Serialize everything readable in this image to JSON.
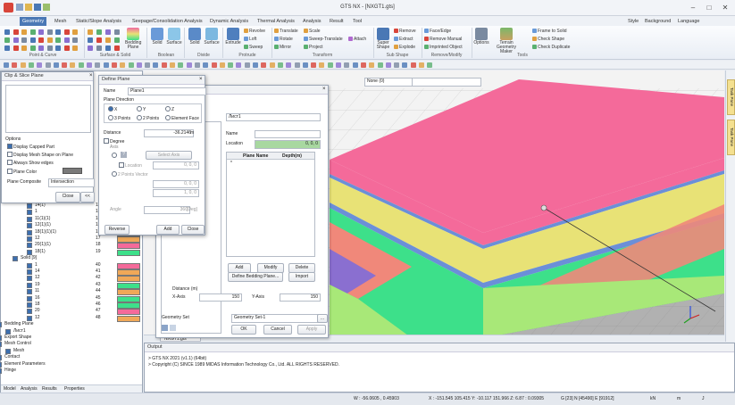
{
  "app": {
    "title": "GTS NX - [NXGT1.gts]"
  },
  "menu": {
    "tabs": [
      "Geometry",
      "Mesh",
      "Static/Slope Analysis",
      "Seepage/Consolidation Analysis",
      "Dynamic Analysis",
      "Thermal Analysis",
      "Analysis",
      "Result",
      "Tool"
    ],
    "right": [
      "Style",
      "Background",
      "Language"
    ]
  },
  "ribbon": {
    "big": [
      "Bedding Plane",
      "Solid",
      "Surface",
      "Solid",
      "Surface",
      "Extrude",
      "Super Shape",
      "Options",
      "Terrain Geometry Maker"
    ],
    "small": {
      "surface_col1": [
        "Revolve",
        "Loft",
        "Sweep"
      ],
      "transform_col1": [
        "Translate",
        "Rotate",
        "Mirror"
      ],
      "transform_col2": [
        "Scale",
        "Sweep-Translate",
        "Project"
      ],
      "transform_col3": [
        "Attach"
      ],
      "sub_col1": [
        "Remove",
        "Extract",
        "Explode"
      ],
      "sub_col2": [
        "Face/Edge",
        "Remove Manual",
        "Imprinted Object"
      ],
      "tools_col1": [
        "Frame to Solid",
        "Check Shape",
        "Check Duplicate"
      ]
    },
    "groups": [
      "Point & Curve",
      "Surface & Solid",
      "Boolean",
      "Divide",
      "Protrude",
      "Transform",
      "Sub Shape",
      "Remove/Modify",
      "Tools"
    ]
  },
  "clip": {
    "title": "Clip & Slice Plane",
    "options_label": "Options",
    "checks": [
      "Display Capped Part",
      "Display Mesh Shape on Plane",
      "Always Show edges",
      "Plane Color"
    ],
    "composite_label": "Plane Composite",
    "composite_value": "Intersection",
    "close_label": "Close",
    "collapse_label": "<<"
  },
  "define_plane": {
    "title": "Define Plane",
    "name_label": "Name",
    "name_value": "Plane1",
    "direction_label": "Plane Direction",
    "dir_x": "X",
    "dir_y": "Y",
    "dir_z": "Z",
    "three_points": "3 Points",
    "two_points": "2 Points",
    "element_face": "Element Face",
    "distance_label": "Distance",
    "distance_value": "-36.2146",
    "distance_unit": "m",
    "degree_label": "Degree",
    "axis_label": "Axis",
    "select_axis": "Select Axis",
    "location_label": "Location",
    "location_value": "0, 0, 0",
    "two_pt_vector": "2 Points Vector",
    "vec1": "0, 0, 0",
    "vec2": "1, 0, 0",
    "angle_label": "Angle",
    "angle_value": "360",
    "angle_unit": "[Deg]",
    "reverse": "Reverse",
    "add": "Add",
    "close": "Close"
  },
  "bedding": {
    "title": "Лист1",
    "name_label": "Name",
    "location_label": "Location",
    "location_value": "0, 0, 0",
    "col_plane": "Plane Name",
    "col_depth": "Depth(m)",
    "row_marker": "*",
    "add": "Add",
    "modify": "Modify",
    "delete": "Delete",
    "define": "Define Bedding Plane...",
    "import": "Import",
    "distance_label": "Distance (m)",
    "xaxis_label": "X-Axis",
    "xaxis_value": "150",
    "yaxis_label": "Y-Axis",
    "yaxis_value": "150",
    "geomset_label": "Geometry Set",
    "geomset_value": "Geometry Set-1",
    "ok": "OK",
    "cancel": "Cancel",
    "apply": "Apply"
  },
  "tree": {
    "rows": [
      {
        "name": "14(1)",
        "num": "11",
        "color": "#f0a858",
        "indent": 38
      },
      {
        "name": "1",
        "num": "13",
        "color": "#f46a9a",
        "indent": 38
      },
      {
        "name": "11(1)(1)",
        "num": "14",
        "color": "#f0a858",
        "indent": 38
      },
      {
        "name": "12(1)(1)",
        "num": "15",
        "color": "#f0a858",
        "indent": 38
      },
      {
        "name": "18(1)(1)(1)",
        "num": "16",
        "color": "#f0a858",
        "indent": 38
      },
      {
        "name": "12",
        "num": "17",
        "color": "#f0a858",
        "indent": 38
      },
      {
        "name": "20(1)(1)",
        "num": "18",
        "color": "#f46a9a",
        "indent": 38
      },
      {
        "name": "18(1)",
        "num": "19",
        "color": "#3de08a",
        "indent": 38
      },
      {
        "name": "Solid [9]",
        "num": "",
        "color": "",
        "indent": 22
      },
      {
        "name": "1",
        "num": "40",
        "color": "#f46a9a",
        "indent": 38
      },
      {
        "name": "14",
        "num": "41",
        "color": "#f0a858",
        "indent": 38
      },
      {
        "name": "12",
        "num": "42",
        "color": "#f0a858",
        "indent": 38
      },
      {
        "name": "19",
        "num": "43",
        "color": "#3de08a",
        "indent": 38
      },
      {
        "name": "11",
        "num": "44",
        "color": "#f0a858",
        "indent": 38
      },
      {
        "name": "16",
        "num": "45",
        "color": "#3de08a",
        "indent": 38
      },
      {
        "name": "18",
        "num": "46",
        "color": "#3de08a",
        "indent": 38
      },
      {
        "name": "20",
        "num": "47",
        "color": "#f46a9a",
        "indent": 38
      },
      {
        "name": "12",
        "num": "48",
        "color": "#f0a858",
        "indent": 38
      },
      {
        "name": "Bedding Plane",
        "num": "",
        "color": "",
        "indent": 4
      },
      {
        "name": "Лист1",
        "num": "",
        "color": "",
        "indent": 14
      },
      {
        "name": "Export Shape",
        "num": "",
        "color": "",
        "indent": 4
      },
      {
        "name": "Mesh Control",
        "num": "",
        "color": "",
        "indent": 4
      },
      {
        "name": "Mesh",
        "num": "",
        "color": "",
        "indent": 14
      },
      {
        "name": "Contact",
        "num": "",
        "color": "",
        "indent": 4
      },
      {
        "name": "Element Parameters",
        "num": "",
        "color": "",
        "indent": 4
      },
      {
        "name": "Hinge",
        "num": "",
        "color": "",
        "indent": 4
      }
    ],
    "bottom_tabs": [
      "Model",
      "Analysis",
      "Results",
      "Properties"
    ]
  },
  "viewport": {
    "doc_tab": "NXGT1.gts",
    "view_combo": "None (0)",
    "side_tabs": [
      "Task Pane",
      "Task Pane"
    ]
  },
  "output": {
    "title": "Output",
    "lines": [
      "> GTS NX 2021 (v1.1) (64bit)",
      "> Copyright (C) SINCE 1989 MIDAS Information Technology Co., Ltd. ALL RIGHTS RESERVED."
    ]
  },
  "status": {
    "w": "W : -56.0605 , 0.45903",
    "xyz": "X : -151.545 105.415  Y: -10.117  151.966  Z: 6.87 : 0.09305",
    "g": "G [23] N [45490] E [91912]",
    "unit1": "kN",
    "unit2": "m",
    "unit3": "J"
  },
  "colors": {
    "pink": "#f46a9a",
    "yellow": "#e8e276",
    "blue": "#6b8fd8",
    "green": "#3de08a",
    "salmon": "#f0887a",
    "purple": "#8a6fd0",
    "lime": "#a8e878",
    "accent": "#4a78b5"
  }
}
